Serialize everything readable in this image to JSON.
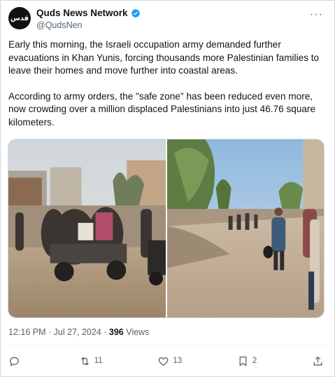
{
  "account": {
    "display_name": "Quds News Network",
    "handle": "@QudsNen",
    "avatar_text": "قدس",
    "verified": true,
    "verified_color": "#1d9bf0"
  },
  "tweet": {
    "paragraphs": [
      "Early this morning, the Israeli occupation army demanded further evacuations in Khan Yunis, forcing thousands more Palestinian families to leave their homes and move further into coastal areas.",
      "According to army orders, the \"safe zone\" has been reduced even more, now crowding over a million displaced Palestinians into just 46.76 square kilometers."
    ],
    "time": "12:16 PM",
    "separator": "·",
    "date": "Jul 27, 2024",
    "views_count": "396",
    "views_label": "Views"
  },
  "actions": {
    "reply": {
      "icon": "reply-icon",
      "count": ""
    },
    "retweet": {
      "icon": "retweet-icon",
      "count": "11"
    },
    "like": {
      "icon": "heart-icon",
      "count": "13"
    },
    "bookmark": {
      "icon": "bookmark-icon",
      "count": "2"
    },
    "share": {
      "icon": "share-icon",
      "count": ""
    }
  },
  "colors": {
    "text": "#0f1419",
    "secondary": "#536471",
    "border": "#cfd9de"
  }
}
